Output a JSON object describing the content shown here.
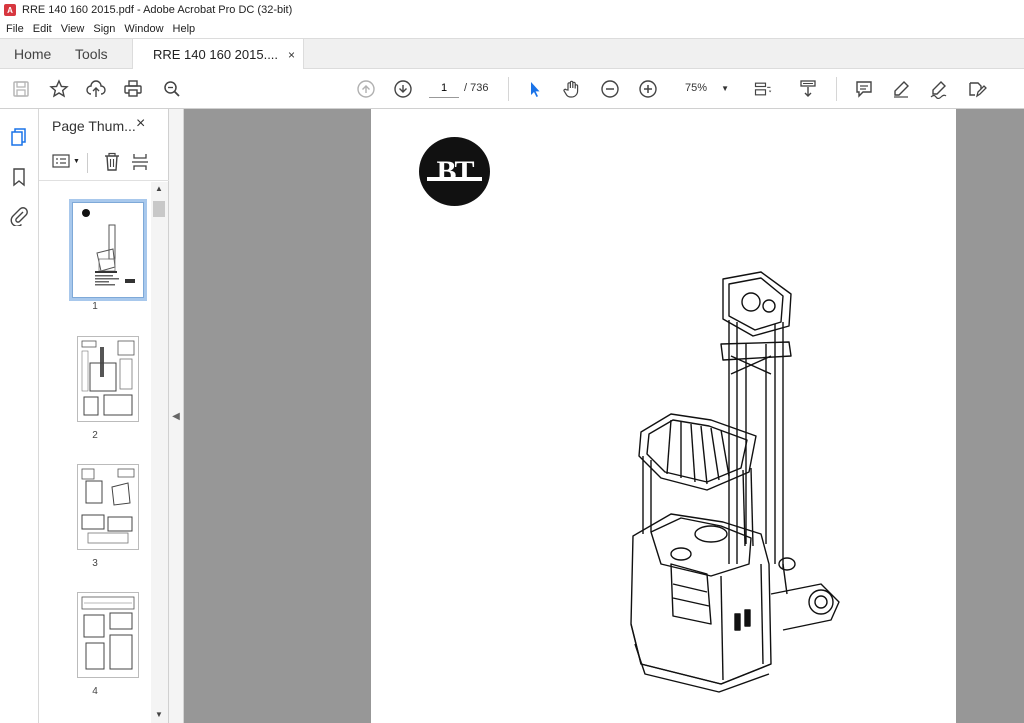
{
  "window": {
    "title": "RRE 140 160 2015.pdf - Adobe Acrobat Pro DC (32-bit)"
  },
  "menu": [
    "File",
    "Edit",
    "View",
    "Sign",
    "Window",
    "Help"
  ],
  "tabs": {
    "home": "Home",
    "tools": "Tools",
    "document": "RRE 140 160 2015....",
    "close": "×"
  },
  "toolbar": {
    "current_page": "1",
    "page_count": "/ 736",
    "zoom": "75%"
  },
  "panel": {
    "title": "Page Thum...",
    "close": "×"
  },
  "thumbnails": [
    {
      "label": "1",
      "selected": true
    },
    {
      "label": "2",
      "selected": false
    },
    {
      "label": "3",
      "selected": false
    },
    {
      "label": "4",
      "selected": false
    }
  ],
  "document": {
    "logo_text": "BT"
  },
  "icons": [
    "save-icon",
    "bookmark-star-icon",
    "upload-cloud-icon",
    "print-icon",
    "zoom-search-icon",
    "page-up-icon",
    "page-down-icon",
    "select-cursor-icon",
    "hand-tool-icon",
    "zoom-out-icon",
    "zoom-in-icon",
    "fit-page-icon",
    "scroll-mode-icon",
    "comment-icon",
    "highlight-pen-icon",
    "sign-icon",
    "fill-sign-icon"
  ],
  "colors": {
    "accent_red": "#d7373f",
    "doc_background": "#979797",
    "selected_thumb": "#a8c8ec",
    "cursor_blue": "#1a73e8"
  }
}
